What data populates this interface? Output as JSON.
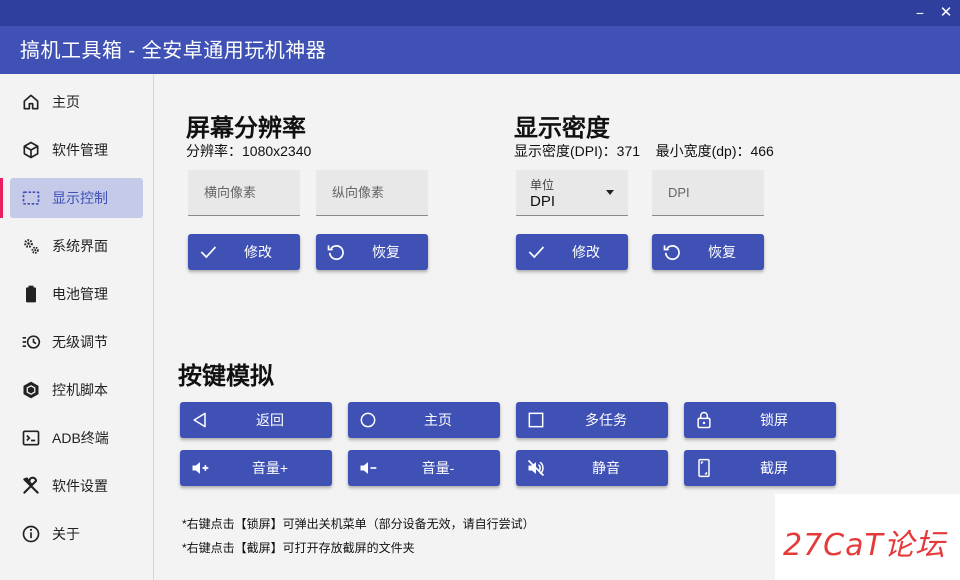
{
  "window": {
    "title": "搞机工具箱 - 全安卓通用玩机神器",
    "minimize_glyph": "−",
    "close_glyph": "✕"
  },
  "sidebar": {
    "items": [
      {
        "label": "主页",
        "icon": "home-icon"
      },
      {
        "label": "软件管理",
        "icon": "package-icon"
      },
      {
        "label": "显示控制",
        "icon": "display-icon",
        "active": true
      },
      {
        "label": "系统界面",
        "icon": "gears-icon"
      },
      {
        "label": "电池管理",
        "icon": "battery-icon"
      },
      {
        "label": "无级调节",
        "icon": "adjust-icon"
      },
      {
        "label": "控机脚本",
        "icon": "hexagon-icon"
      },
      {
        "label": "ADB终端",
        "icon": "terminal-icon"
      },
      {
        "label": "软件设置",
        "icon": "tools-icon"
      },
      {
        "label": "关于",
        "icon": "info-icon"
      }
    ]
  },
  "resolution": {
    "title": "屏幕分辨率",
    "info": "分辨率：1080x2340",
    "width_placeholder": "横向像素",
    "height_placeholder": "纵向像素",
    "modify_label": "修改",
    "restore_label": "恢复"
  },
  "density": {
    "title": "显示密度",
    "info": "显示密度(DPI)：371    最小宽度(dp)：466",
    "unit_label": "单位",
    "unit_value": "DPI",
    "dpi_placeholder": "DPI",
    "modify_label": "修改",
    "restore_label": "恢复"
  },
  "keys": {
    "title": "按键模拟",
    "buttons": [
      {
        "label": "返回",
        "icon": "back-icon"
      },
      {
        "label": "主页",
        "icon": "circle-icon"
      },
      {
        "label": "多任务",
        "icon": "square-icon"
      },
      {
        "label": "锁屏",
        "icon": "lock-icon"
      },
      {
        "label": "音量+",
        "icon": "volume-up-icon"
      },
      {
        "label": "音量-",
        "icon": "volume-down-icon"
      },
      {
        "label": "静音",
        "icon": "mute-icon"
      },
      {
        "label": "截屏",
        "icon": "screenshot-icon"
      }
    ],
    "note1": "*右键点击【锁屏】可弹出关机菜单（部分设备无效，请自行尝试）",
    "note2": "*右键点击【截屏】可打开存放截屏的文件夹"
  },
  "watermark": {
    "text": "27CaT论坛"
  },
  "colors": {
    "accent": "#3f51b5",
    "titlebar": "#2f3f9e",
    "active_bg": "#c5cae9",
    "active_marker": "#e91e63"
  }
}
